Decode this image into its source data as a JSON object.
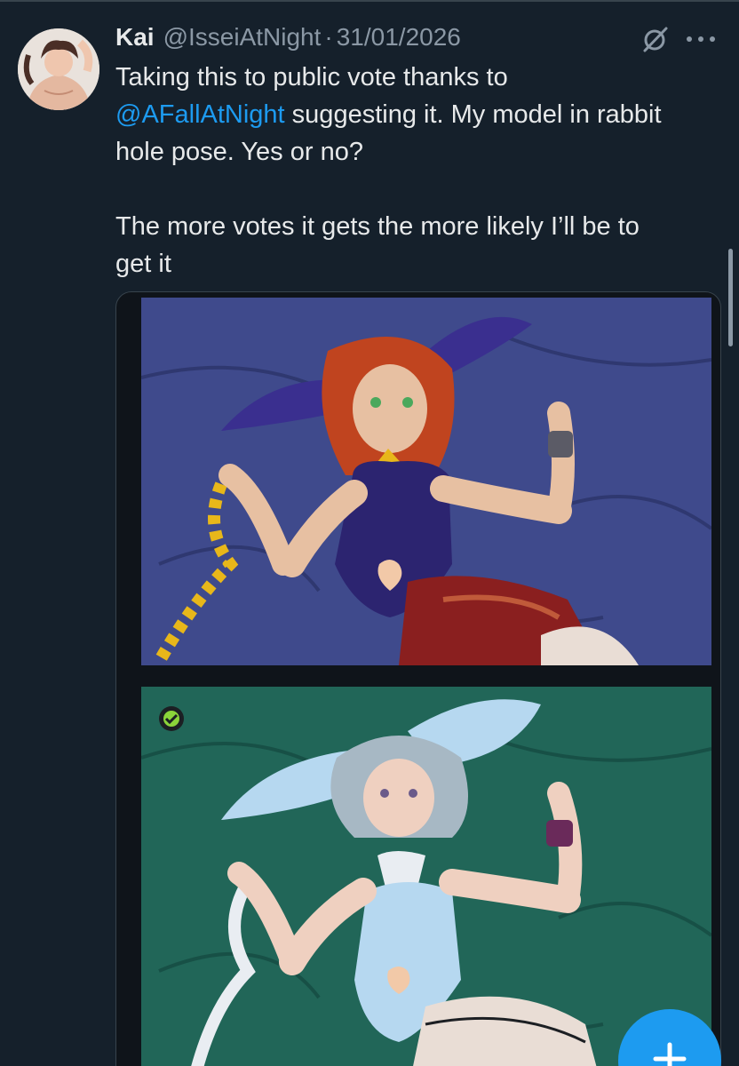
{
  "tweet": {
    "author_name": "Kai",
    "handle": "@IsseiAtNight",
    "separator": "·",
    "date": "31/01/2026",
    "text_line1": "Taking this to public vote thanks to",
    "mention": "@AFallAtNight",
    "text_line2_rest": " suggesting it. My model in rabbit",
    "text_line3": "hole pose. Yes or no?",
    "text_para2_line1": "The more votes it gets the more likely I’ll be to",
    "text_para2_line2": "get it"
  },
  "icons": {
    "grok": "grok-icon",
    "more": "more-dots-icon",
    "compose": "plus-icon"
  },
  "colors": {
    "background": "#15202b",
    "text": "#e7e9ea",
    "secondary": "#8b98a5",
    "accent": "#1d9bf0",
    "image1_bg": "#3f4a8c",
    "image2_bg": "#216658"
  }
}
